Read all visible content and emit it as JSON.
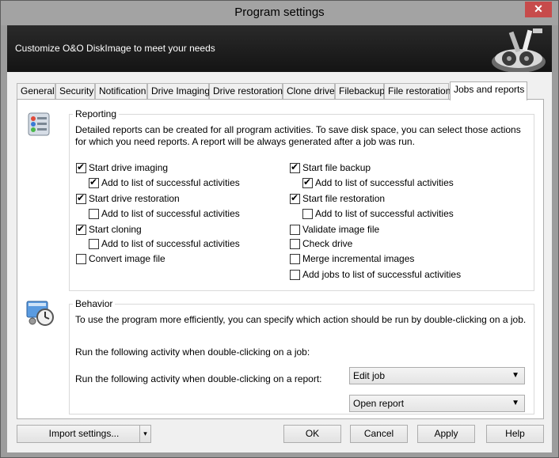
{
  "window": {
    "title": "Program settings",
    "close_glyph": "✕"
  },
  "header": {
    "text": "Customize O&O DiskImage to meet your needs"
  },
  "tabs": [
    {
      "label": "General"
    },
    {
      "label": "Security"
    },
    {
      "label": "Notification"
    },
    {
      "label": "Drive Imaging"
    },
    {
      "label": "Drive restoration"
    },
    {
      "label": "Clone drive"
    },
    {
      "label": "Filebackup"
    },
    {
      "label": "File restoration"
    },
    {
      "label": "Jobs and reports",
      "active": true
    }
  ],
  "reporting": {
    "legend": "Reporting",
    "icon": "report-list-icon",
    "description": "Detailed reports can be created for all program activities. To save disk space, you can select those actions for which you need reports. A report will be always generated after a job was run.",
    "left": [
      {
        "label": "Start drive imaging",
        "checked": true
      },
      {
        "label": "Add to list of successful activities",
        "checked": true
      },
      {
        "label": "Start drive restoration",
        "checked": true
      },
      {
        "label": "Add to list of successful activities",
        "checked": false
      },
      {
        "label": "Start cloning",
        "checked": true
      },
      {
        "label": "Add to list of successful activities",
        "checked": false
      },
      {
        "label": "Convert image file",
        "checked": false
      }
    ],
    "right": [
      {
        "label": "Start file backup",
        "checked": true
      },
      {
        "label": "Add to list of successful activities",
        "checked": true
      },
      {
        "label": "Start file restoration",
        "checked": true
      },
      {
        "label": "Add to list of successful activities",
        "checked": false
      },
      {
        "label": "Validate image file",
        "checked": false
      },
      {
        "label": "Check drive",
        "checked": false
      },
      {
        "label": "Merge incremental images",
        "checked": false
      },
      {
        "label": "Add jobs to list of successful activities",
        "checked": false
      }
    ]
  },
  "behavior": {
    "legend": "Behavior",
    "icon": "clock-settings-icon",
    "description": "To use the program more efficiently, you can specify which action should be run by double-clicking on a job.",
    "job_label": "Run the following activity when double-clicking on a job:",
    "job_value": "Edit job",
    "report_label": "Run the following activity when double-clicking on a report:",
    "report_value": "Open report",
    "arrow_glyph": "▼"
  },
  "footer": {
    "import_label": "Import settings...",
    "import_arrow": "▾",
    "ok_label": "OK",
    "cancel_label": "Cancel",
    "apply_label": "Apply",
    "help_label": "Help"
  },
  "colors": {
    "header_bg": "#1c1c1c",
    "title_bar": "#a3a3a3",
    "close": "#c74b4b"
  }
}
